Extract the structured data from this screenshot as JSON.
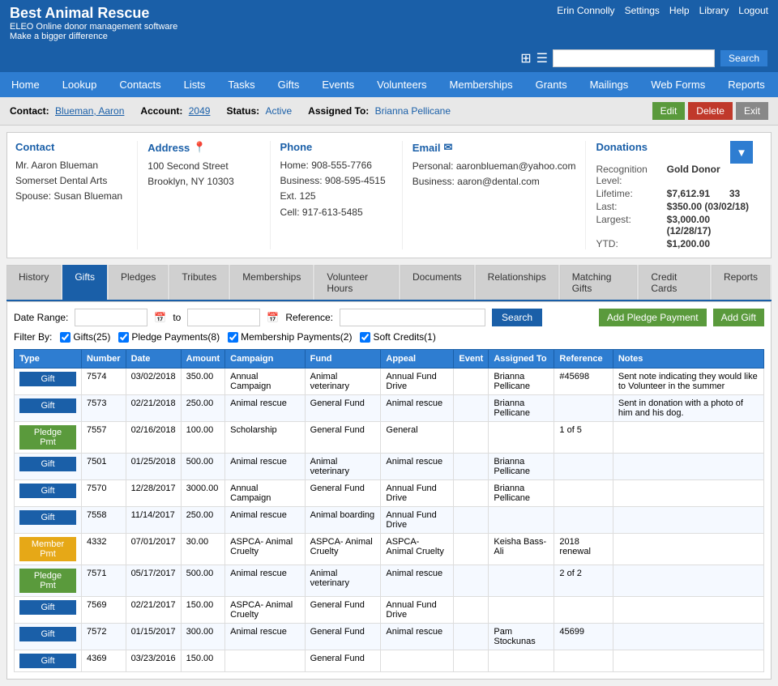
{
  "header": {
    "title": "Best Animal Rescue",
    "subtitle1": "ELEO Online donor management software",
    "subtitle2": "Make a bigger difference",
    "user": "Erin Connolly",
    "nav_links": [
      "Settings",
      "Help",
      "Library",
      "Logout"
    ],
    "search_placeholder": ""
  },
  "nav": {
    "items": [
      "Home",
      "Lookup",
      "Contacts",
      "Lists",
      "Tasks",
      "Gifts",
      "Events",
      "Volunteers",
      "Memberships",
      "Grants",
      "Mailings",
      "Web Forms",
      "Reports"
    ]
  },
  "contact_bar": {
    "contact_label": "Contact:",
    "contact_value": "Blueman, Aaron",
    "account_label": "Account:",
    "account_value": "2049",
    "status_label": "Status:",
    "status_value": "Active",
    "assigned_label": "Assigned To:",
    "assigned_value": "Brianna Pellicane",
    "btn_edit": "Edit",
    "btn_delete": "Delete",
    "btn_exit": "Exit"
  },
  "contact_info": {
    "contact": {
      "title": "Contact",
      "lines": [
        "Mr. Aaron Blueman",
        "Somerset Dental Arts",
        "Spouse: Susan Blueman"
      ]
    },
    "address": {
      "title": "Address",
      "lines": [
        "100 Second Street",
        "Brooklyn, NY 10303"
      ]
    },
    "phone": {
      "title": "Phone",
      "home_label": "Home:",
      "home_value": "908-555-7766",
      "business_label": "Business:",
      "business_value": "908-595-4515 Ext. 125",
      "cell_label": "Cell:",
      "cell_value": "917-613-5485"
    },
    "email": {
      "title": "Email",
      "personal_label": "Personal:",
      "personal_value": "aaronblueman@yahoo.com",
      "business_label": "Business:",
      "business_value": "aaron@dental.com"
    },
    "donations": {
      "title": "Donations",
      "recognition_label": "Recognition Level:",
      "recognition_value": "Gold Donor",
      "lifetime_label": "Lifetime:",
      "lifetime_value": "$7,612.91",
      "lifetime_count": "33",
      "last_label": "Last:",
      "last_value": "$350.00 (03/02/18)",
      "largest_label": "Largest:",
      "largest_value": "$3,000.00 (12/28/17)",
      "ytd_label": "YTD:",
      "ytd_value": "$1,200.00"
    }
  },
  "tabs": {
    "items": [
      "History",
      "Gifts",
      "Pledges",
      "Tributes",
      "Memberships",
      "Volunteer Hours",
      "Documents",
      "Relationships",
      "Matching Gifts",
      "Credit Cards",
      "Reports"
    ],
    "active": "Gifts"
  },
  "gifts_panel": {
    "date_range_label": "Date Range:",
    "date_to": "to",
    "reference_label": "Reference:",
    "btn_search": "Search",
    "btn_add_pledge": "Add Pledge Payment",
    "btn_add_gift": "Add Gift",
    "filter_label": "Filter By:",
    "filters": [
      {
        "label": "Gifts(25)",
        "checked": true
      },
      {
        "label": "Pledge Payments(8)",
        "checked": true
      },
      {
        "label": "Membership Payments(2)",
        "checked": true
      },
      {
        "label": "Soft Credits(1)",
        "checked": true
      }
    ],
    "table_headers": [
      "Type",
      "Number",
      "Date",
      "Amount",
      "Campaign",
      "Fund",
      "Appeal",
      "Event",
      "Assigned To",
      "Reference",
      "Notes"
    ],
    "rows": [
      {
        "type": "Gift",
        "type_class": "btn-gift",
        "number": "7574",
        "date": "03/02/2018",
        "amount": "350.00",
        "campaign": "Annual Campaign",
        "fund": "Animal veterinary",
        "appeal": "Annual Fund Drive",
        "event": "",
        "assigned_to": "Brianna Pellicane",
        "reference": "#45698",
        "notes": "Sent note indicating they would like to Volunteer in the summer"
      },
      {
        "type": "Gift",
        "type_class": "btn-gift",
        "number": "7573",
        "date": "02/21/2018",
        "amount": "250.00",
        "campaign": "Animal rescue",
        "fund": "General Fund",
        "appeal": "Animal rescue",
        "event": "",
        "assigned_to": "Brianna Pellicane",
        "reference": "",
        "notes": "Sent in donation with a photo of him and his dog."
      },
      {
        "type": "Pledge Pmt",
        "type_class": "btn-pledge",
        "number": "7557",
        "date": "02/16/2018",
        "amount": "100.00",
        "campaign": "Scholarship",
        "fund": "General Fund",
        "appeal": "General",
        "event": "",
        "assigned_to": "",
        "reference": "1 of 5",
        "notes": ""
      },
      {
        "type": "Gift",
        "type_class": "btn-gift",
        "number": "7501",
        "date": "01/25/2018",
        "amount": "500.00",
        "campaign": "Animal rescue",
        "fund": "Animal veterinary",
        "appeal": "Animal rescue",
        "event": "",
        "assigned_to": "Brianna Pellicane",
        "reference": "",
        "notes": ""
      },
      {
        "type": "Gift",
        "type_class": "btn-gift",
        "number": "7570",
        "date": "12/28/2017",
        "amount": "3000.00",
        "campaign": "Annual Campaign",
        "fund": "General Fund",
        "appeal": "Annual Fund Drive",
        "event": "",
        "assigned_to": "Brianna Pellicane",
        "reference": "",
        "notes": ""
      },
      {
        "type": "Gift",
        "type_class": "btn-gift",
        "number": "7558",
        "date": "11/14/2017",
        "amount": "250.00",
        "campaign": "Animal rescue",
        "fund": "Animal boarding",
        "appeal": "Annual Fund Drive",
        "event": "",
        "assigned_to": "",
        "reference": "",
        "notes": ""
      },
      {
        "type": "Member Pmt",
        "type_class": "btn-member",
        "number": "4332",
        "date": "07/01/2017",
        "amount": "30.00",
        "campaign": "ASPCA- Animal Cruelty",
        "fund": "ASPCA- Animal Cruelty",
        "appeal": "ASPCA- Animal Cruelty",
        "event": "",
        "assigned_to": "Keisha Bass-Ali",
        "reference": "2018 renewal",
        "notes": ""
      },
      {
        "type": "Pledge Pmt",
        "type_class": "btn-pledge",
        "number": "7571",
        "date": "05/17/2017",
        "amount": "500.00",
        "campaign": "Animal rescue",
        "fund": "Animal veterinary",
        "appeal": "Animal rescue",
        "event": "",
        "assigned_to": "",
        "reference": "2 of 2",
        "notes": ""
      },
      {
        "type": "Gift",
        "type_class": "btn-gift",
        "number": "7569",
        "date": "02/21/2017",
        "amount": "150.00",
        "campaign": "ASPCA- Animal Cruelty",
        "fund": "General Fund",
        "appeal": "Annual Fund Drive",
        "event": "",
        "assigned_to": "",
        "reference": "",
        "notes": ""
      },
      {
        "type": "Gift",
        "type_class": "btn-gift",
        "number": "7572",
        "date": "01/15/2017",
        "amount": "300.00",
        "campaign": "Animal rescue",
        "fund": "General Fund",
        "appeal": "Animal rescue",
        "event": "",
        "assigned_to": "Pam Stockunas",
        "reference": "45699",
        "notes": ""
      },
      {
        "type": "Gift",
        "type_class": "btn-gift",
        "number": "4369",
        "date": "03/23/2016",
        "amount": "150.00",
        "campaign": "",
        "fund": "General Fund",
        "appeal": "",
        "event": "",
        "assigned_to": "",
        "reference": "",
        "notes": ""
      }
    ]
  }
}
